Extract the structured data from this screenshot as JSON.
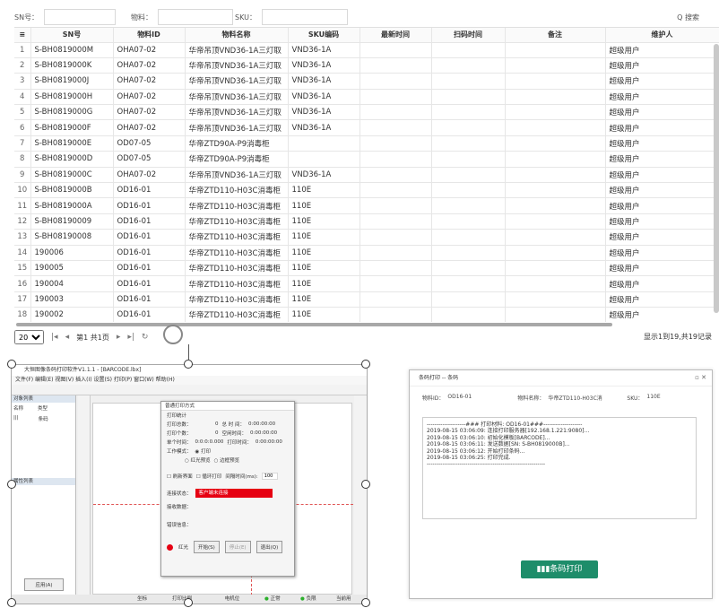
{
  "search": {
    "sn_label": "SN号：",
    "material_label": "物料：",
    "sku_label": "SKU：",
    "search_btn": "Q 搜索"
  },
  "table": {
    "headers": [
      "≡",
      "SN号",
      "物料ID",
      "物料名称",
      "SKU编码",
      "最新时间",
      "扫码时间",
      "备注",
      "维护人"
    ],
    "rows": [
      [
        "1",
        "S-BH0819000M",
        "OHA07-02",
        "华帝吊顶VND36-1A三灯取",
        "VND36-1A",
        "",
        "",
        "",
        "超级用户"
      ],
      [
        "2",
        "S-BH0819000K",
        "OHA07-02",
        "华帝吊顶VND36-1A三灯取",
        "VND36-1A",
        "",
        "",
        "",
        "超级用户"
      ],
      [
        "3",
        "S-BH0819000J",
        "OHA07-02",
        "华帝吊顶VND36-1A三灯取",
        "VND36-1A",
        "",
        "",
        "",
        "超级用户"
      ],
      [
        "4",
        "S-BH0819000H",
        "OHA07-02",
        "华帝吊顶VND36-1A三灯取",
        "VND36-1A",
        "",
        "",
        "",
        "超级用户"
      ],
      [
        "5",
        "S-BH0819000G",
        "OHA07-02",
        "华帝吊顶VND36-1A三灯取",
        "VND36-1A",
        "",
        "",
        "",
        "超级用户"
      ],
      [
        "6",
        "S-BH0819000F",
        "OHA07-02",
        "华帝吊顶VND36-1A三灯取",
        "VND36-1A",
        "",
        "",
        "",
        "超级用户"
      ],
      [
        "7",
        "S-BH0819000E",
        "OD07-05",
        "华帝ZTD90A-P9消毒柜",
        "",
        "",
        "",
        "",
        "超级用户"
      ],
      [
        "8",
        "S-BH0819000D",
        "OD07-05",
        "华帝ZTD90A-P9消毒柜",
        "",
        "",
        "",
        "",
        "超级用户"
      ],
      [
        "9",
        "S-BH0819000C",
        "OHA07-02",
        "华帝吊顶VND36-1A三灯取",
        "VND36-1A",
        "",
        "",
        "",
        "超级用户"
      ],
      [
        "10",
        "S-BH0819000B",
        "OD16-01",
        "华帝ZTD110-H03C消毒柜",
        "110E",
        "",
        "",
        "",
        "超级用户"
      ],
      [
        "11",
        "S-BH0819000A",
        "OD16-01",
        "华帝ZTD110-H03C消毒柜",
        "110E",
        "",
        "",
        "",
        "超级用户"
      ],
      [
        "12",
        "S-BH08190009",
        "OD16-01",
        "华帝ZTD110-H03C消毒柜",
        "110E",
        "",
        "",
        "",
        "超级用户"
      ],
      [
        "13",
        "S-BH08190008",
        "OD16-01",
        "华帝ZTD110-H03C消毒柜",
        "110E",
        "",
        "",
        "",
        "超级用户"
      ],
      [
        "14",
        "190006",
        "OD16-01",
        "华帝ZTD110-H03C消毒柜",
        "110E",
        "",
        "",
        "",
        "超级用户"
      ],
      [
        "15",
        "190005",
        "OD16-01",
        "华帝ZTD110-H03C消毒柜",
        "110E",
        "",
        "",
        "",
        "超级用户"
      ],
      [
        "16",
        "190004",
        "OD16-01",
        "华帝ZTD110-H03C消毒柜",
        "110E",
        "",
        "",
        "",
        "超级用户"
      ],
      [
        "17",
        "190003",
        "OD16-01",
        "华帝ZTD110-H03C消毒柜",
        "110E",
        "",
        "",
        "",
        "超级用户"
      ],
      [
        "18",
        "190002",
        "OD16-01",
        "华帝ZTD110-H03C消毒柜",
        "110E",
        "",
        "",
        "",
        "超级用户"
      ]
    ]
  },
  "pager": {
    "page_size": "20",
    "page_text": "第1 共1页",
    "info": "显示1到19,共19记录"
  },
  "designer": {
    "title": "大恒图像条码打印软件V1.1.1 - [BARCODE.lbx]",
    "menu": "文件(F)  编辑(E)  视图(V)  插入(I)  设置(S)  打印(P)  窗口(W)  帮助(H)",
    "left_panel_title": "对象列表",
    "left_col1": "名称",
    "left_col2": "类型",
    "left_item_type": "条码",
    "left_panel_title2": "属性列表",
    "left_footer_btn": "应用(A)",
    "status_coord": "坐标系：",
    "status_print": "打印比例 2.782x",
    "status_machine": "电机位置：",
    "status_ok": "正常位",
    "status_neg": "负限位",
    "status_user": "当前用户:Kang",
    "dialog": {
      "title": "普通打印方式",
      "section": "打印统计",
      "total_label": "打印总数：",
      "total_value": "0",
      "total_time_label": "总 时 间：",
      "total_time": "0:00:00:00",
      "done_label": "打印个数：",
      "done_value": "0",
      "empty_time_label": "空闲时间：",
      "empty_time": "0:00:00:00",
      "single_label": "单个时间：",
      "single_value": "0:0:0:0.000",
      "print_time_label": "打印时间：",
      "print_time": "0:00:00:00",
      "mode_label": "工作模式：",
      "mode_print": "打印",
      "mode_red": "红光预览",
      "mode_edge": "边框预览",
      "chk_interface": "刷新界面",
      "chk_loop": "循环打印",
      "interval_label": "间隔时间(ms):",
      "interval_value": "100",
      "conn_label": "连接状态：",
      "conn_status": "客户端未连接",
      "recv_label": "接收数据：",
      "error_label": "错误信息：",
      "btn_red": "红光",
      "btn_start": "开始(S)",
      "btn_stop": "停止(E)",
      "btn_exit": "退出(Q)"
    }
  },
  "barcode": {
    "title": "条码打印 -- 条码",
    "material_id_label": "物料ID：",
    "material_id": "OD16-01",
    "material_name_label": "物料名称：",
    "material_name": "华帝ZTD110-H03C消",
    "sku_label": "SKU：",
    "sku": "110E",
    "log": "--------------------### 打印材料: OD16-01###--------------------\n2019-08-15 03:06:09: 连接打印服务器[192.168.1.221:9080]...\n2019-08-15 03:06:10: 初始化模板[BARCODE]...\n2019-08-15 03:06:11: 发送数据[SN: S-BH0819000B]...\n2019-08-15 03:06:12: 开始打印条码...\n2019-08-15 03:06:25: 打印完成.\n-------------------------------------------------------------",
    "print_btn": "条码打印"
  }
}
